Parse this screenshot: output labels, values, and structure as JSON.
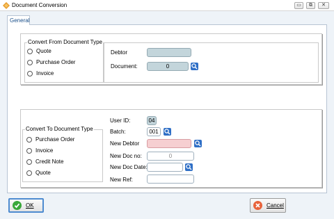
{
  "window": {
    "title": "Document Conversion",
    "controls": {
      "minimize": "▭",
      "maximize": "⧉",
      "close": "✕"
    }
  },
  "tabs": [
    {
      "label": "General"
    }
  ],
  "convert_from": {
    "legend": "Convert From Document Type",
    "options": [
      "Quote",
      "Purchase Order",
      "Invoice"
    ],
    "debtor_label": "Debtor",
    "debtor_value": "",
    "document_label": "Document:",
    "document_value": "0"
  },
  "convert_to": {
    "legend": "Convert To Document Type",
    "options": [
      "Purchase Order",
      "Invoice",
      "Credit Note",
      "Quote"
    ],
    "user_id_label": "User ID:",
    "user_id_value": "04",
    "batch_label": "Batch:",
    "batch_value": "001",
    "new_debtor_label": "New Debtor",
    "new_debtor_value": "",
    "new_doc_no_label": "New Doc no:",
    "new_doc_no_value": "0",
    "new_doc_date_label": "New Doc Date:",
    "new_doc_date_value": "",
    "new_ref_label": "New Ref:",
    "new_ref_value": ""
  },
  "buttons": {
    "ok_label": "OK",
    "cancel_label": "Cancel"
  },
  "colors": {
    "accent": "#4d8bd0",
    "lookup_blue": "#2f6fc6",
    "required_field": "#f6cfd1",
    "readonly_field": "#c3d5db"
  },
  "icons": {
    "app": "app-diamond-icon",
    "lookup": "magnifier-icon",
    "ok": "check-icon",
    "cancel": "cancel-x-icon"
  }
}
